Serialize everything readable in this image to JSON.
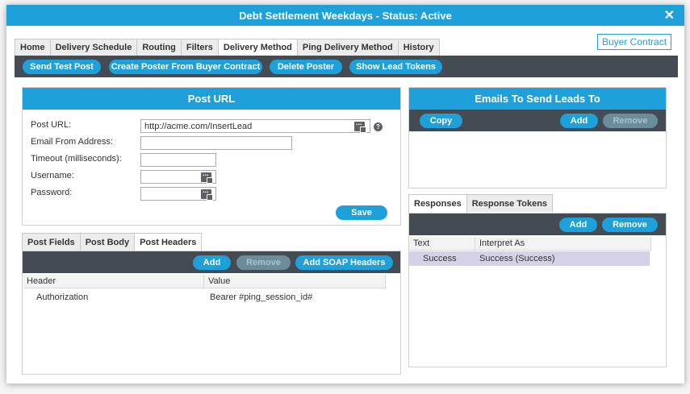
{
  "window": {
    "title": "Debt Settlement Weekdays - Status: Active",
    "close_glyph": "✕"
  },
  "tabs": [
    "Home",
    "Delivery Schedule",
    "Routing",
    "Filters",
    "Delivery Method",
    "Ping Delivery Method",
    "History"
  ],
  "active_tab": "Delivery Method",
  "buyer_contract_link": "Buyer Contract",
  "actions": {
    "send_test_post": "Send Test Post",
    "create_poster": "Create Poster From Buyer Contract",
    "delete_poster": "Delete Poster",
    "show_lead_tokens": "Show Lead Tokens"
  },
  "post_url_panel": {
    "title": "Post URL",
    "fields": {
      "post_url_label": "Post URL:",
      "post_url_value": "http://acme.com/InsertLead",
      "email_from_label": "Email From Address:",
      "email_from_value": "",
      "timeout_label": "Timeout (milliseconds):",
      "timeout_value": "",
      "username_label": "Username:",
      "username_value": "",
      "password_label": "Password:",
      "password_value": ""
    },
    "help_glyph": "?",
    "save_label": "Save"
  },
  "post_tabs": [
    "Post Fields",
    "Post Body",
    "Post Headers"
  ],
  "post_tabs_active": "Post Headers",
  "headers_toolbar": {
    "add": "Add",
    "remove": "Remove",
    "add_soap": "Add SOAP Headers"
  },
  "headers_grid": {
    "columns": [
      "Header",
      "Value"
    ],
    "rows": [
      {
        "header": "Authorization",
        "value": "Bearer #ping_session_id#"
      }
    ]
  },
  "emails_panel": {
    "title": "Emails To Send Leads To",
    "copy": "Copy",
    "add": "Add",
    "remove": "Remove"
  },
  "response_tabs": [
    "Responses",
    "Response Tokens"
  ],
  "response_tabs_active": "Responses",
  "responses_toolbar": {
    "add": "Add",
    "remove": "Remove"
  },
  "responses_grid": {
    "columns": [
      "Text",
      "Interpret As"
    ],
    "rows": [
      {
        "text": "Success",
        "interpret": "Success (Success)"
      }
    ]
  },
  "colors": {
    "accent": "#1ea0db",
    "toolbar": "#454b52",
    "selected_row": "#d4d2e6"
  },
  "icons": [
    "close-icon",
    "ellipsis-picker-icon",
    "help-icon"
  ]
}
